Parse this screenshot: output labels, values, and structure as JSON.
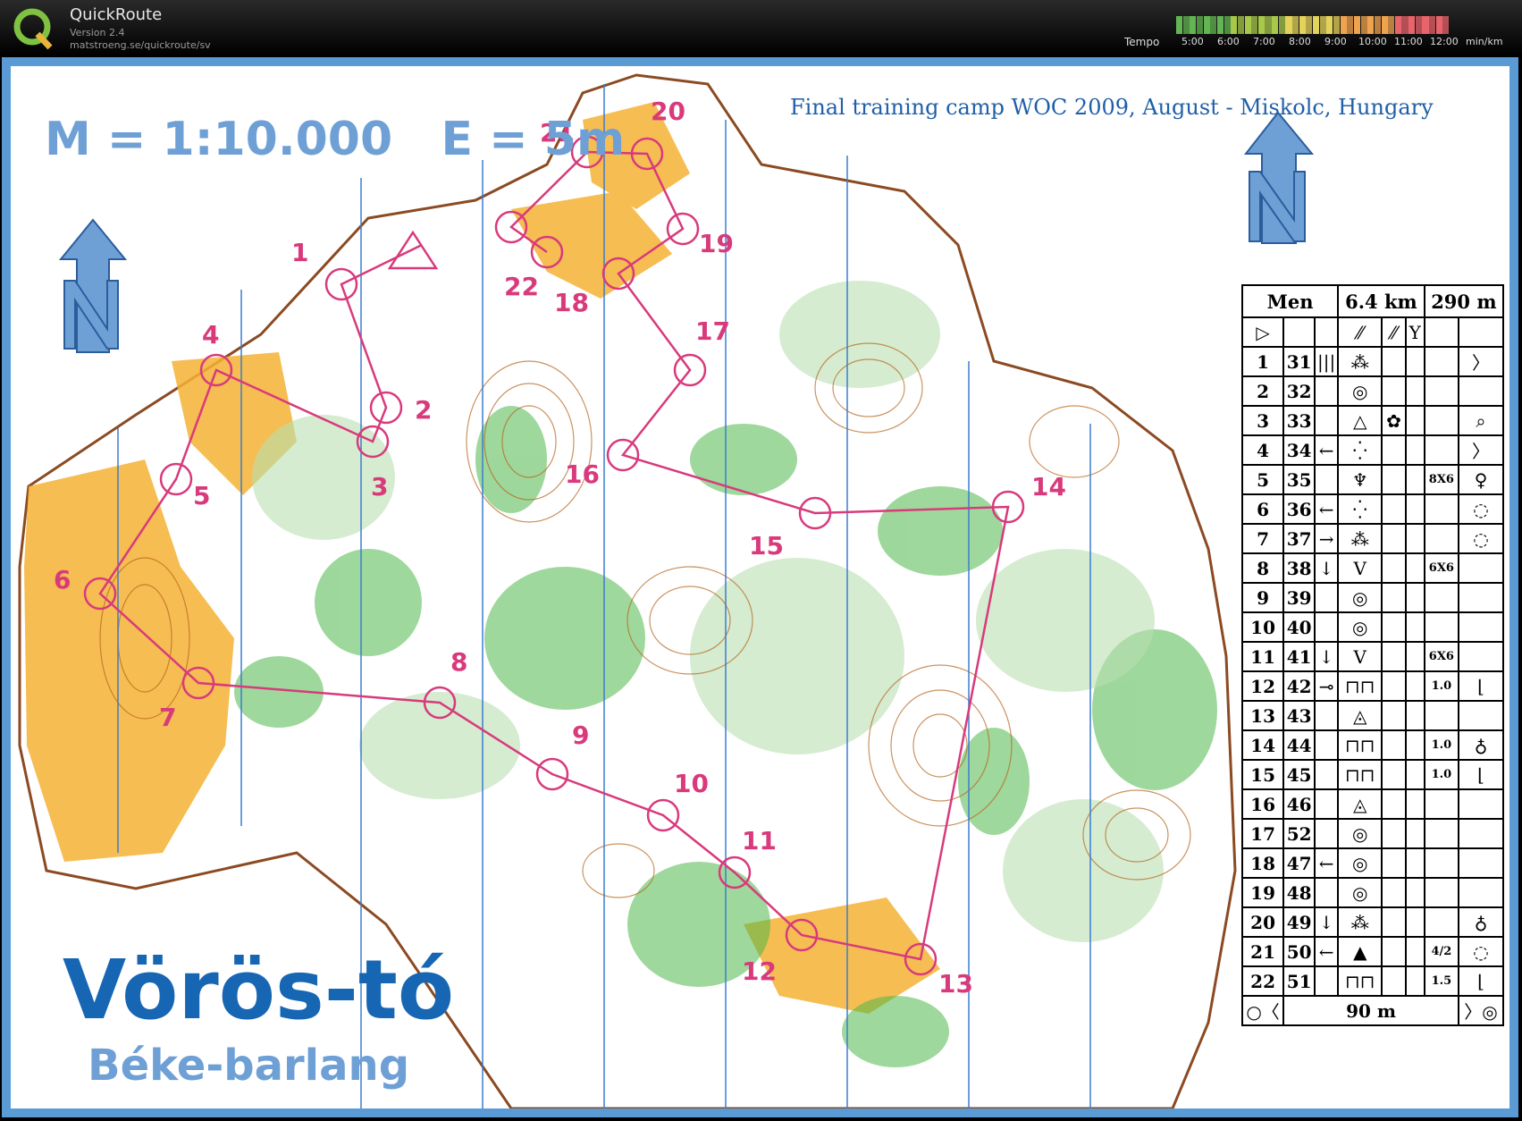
{
  "app": {
    "name": "QuickRoute",
    "version": "Version 2.4",
    "url": "matstroeng.se/quickroute/sv",
    "tempo_label": "Tempo",
    "tempo_ticks": [
      "5:00",
      "6:00",
      "7:00",
      "8:00",
      "9:00",
      "10:00",
      "11:00",
      "12:00",
      "min/km"
    ],
    "tempo_colors": [
      "#62b552",
      "#a8c84a",
      "#e4d35a",
      "#f0a34e",
      "#e8636a"
    ]
  },
  "map": {
    "scale_text": "M = 1:10.000   E = 5m",
    "event_title": "Final training camp WOC 2009, August - Miskolc, Hungary",
    "area_name": "Vörös-tó",
    "area_sub": "Béke-barlang",
    "course_color": "#d83a7c",
    "north_arrow_color": "#6ea0d6",
    "controls": [
      "1",
      "2",
      "3",
      "4",
      "5",
      "6",
      "7",
      "8",
      "9",
      "10",
      "11",
      "12",
      "13",
      "14",
      "15",
      "16",
      "17",
      "18",
      "19",
      "20",
      "21",
      "22"
    ]
  },
  "description": {
    "class": "Men",
    "length": "6.4 km",
    "climb": "290 m",
    "finish_distance": "90 m",
    "rows": [
      {
        "n": "1",
        "code": "31",
        "c": "|||",
        "d": "⁂",
        "g": "",
        "f": "",
        "h": "〉"
      },
      {
        "n": "2",
        "code": "32",
        "c": "",
        "d": "◎",
        "g": "",
        "f": "",
        "h": ""
      },
      {
        "n": "3",
        "code": "33",
        "c": "",
        "d": "△",
        "g": "✿",
        "f": "",
        "h": "⌕"
      },
      {
        "n": "4",
        "code": "34",
        "c": "←",
        "d": "⁛",
        "g": "",
        "f": "",
        "h": "〉"
      },
      {
        "n": "5",
        "code": "35",
        "c": "",
        "d": "♆",
        "g": "",
        "f": "8X6",
        "h": "♀"
      },
      {
        "n": "6",
        "code": "36",
        "c": "←",
        "d": "⁛",
        "g": "",
        "f": "",
        "h": "◌"
      },
      {
        "n": "7",
        "code": "37",
        "c": "→",
        "d": "⁂",
        "g": "",
        "f": "",
        "h": "◌"
      },
      {
        "n": "8",
        "code": "38",
        "c": "↓",
        "d": "V",
        "g": "",
        "f": "6X6",
        "h": ""
      },
      {
        "n": "9",
        "code": "39",
        "c": "",
        "d": "◎",
        "g": "",
        "f": "",
        "h": ""
      },
      {
        "n": "10",
        "code": "40",
        "c": "",
        "d": "◎",
        "g": "",
        "f": "",
        "h": ""
      },
      {
        "n": "11",
        "code": "41",
        "c": "↓",
        "d": "V",
        "g": "",
        "f": "6X6",
        "h": ""
      },
      {
        "n": "12",
        "code": "42",
        "c": "⊸",
        "d": "⊓⊓",
        "g": "",
        "f": "1.0",
        "h": "⌊"
      },
      {
        "n": "13",
        "code": "43",
        "c": "",
        "d": "◬",
        "g": "",
        "f": "",
        "h": ""
      },
      {
        "n": "14",
        "code": "44",
        "c": "",
        "d": "⊓⊓",
        "g": "",
        "f": "1.0",
        "h": "♁"
      },
      {
        "n": "15",
        "code": "45",
        "c": "",
        "d": "⊓⊓",
        "g": "",
        "f": "1.0",
        "h": "⌊"
      },
      {
        "n": "16",
        "code": "46",
        "c": "",
        "d": "◬",
        "g": "",
        "f": "",
        "h": ""
      },
      {
        "n": "17",
        "code": "52",
        "c": "",
        "d": "◎",
        "g": "",
        "f": "",
        "h": ""
      },
      {
        "n": "18",
        "code": "47",
        "c": "←",
        "d": "◎",
        "g": "",
        "f": "",
        "h": ""
      },
      {
        "n": "19",
        "code": "48",
        "c": "",
        "d": "◎",
        "g": "",
        "f": "",
        "h": ""
      },
      {
        "n": "20",
        "code": "49",
        "c": "↓",
        "d": "⁂",
        "g": "",
        "f": "",
        "h": "♁"
      },
      {
        "n": "21",
        "code": "50",
        "c": "←",
        "d": "▲",
        "g": "",
        "f": "4/2",
        "h": "◌"
      },
      {
        "n": "22",
        "code": "51",
        "c": "",
        "d": "⊓⊓",
        "g": "",
        "f": "1.5",
        "h": "⌊"
      }
    ]
  }
}
